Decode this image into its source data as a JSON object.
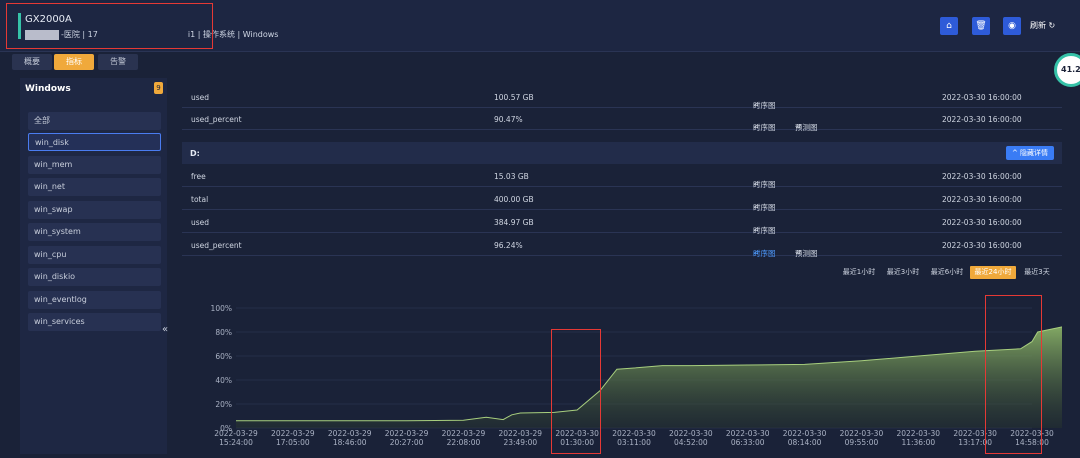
{
  "header": {
    "host_name": "GX2000A",
    "host_info_1": "-医院 | 17",
    "host_info_2": "i1 | 操作系统 | Windows",
    "refresh_label": "刷新"
  },
  "tabs": [
    {
      "label": "概要"
    },
    {
      "label": "指标"
    },
    {
      "label": "告警"
    }
  ],
  "gauge": {
    "value": "41.21"
  },
  "sidebar": {
    "title": "Windows",
    "badge": "9",
    "items": [
      {
        "label": "全部"
      },
      {
        "label": "win_disk"
      },
      {
        "label": "win_mem"
      },
      {
        "label": "win_net"
      },
      {
        "label": "win_swap"
      },
      {
        "label": "win_system"
      },
      {
        "label": "win_cpu"
      },
      {
        "label": "win_diskio"
      },
      {
        "label": "win_eventlog"
      },
      {
        "label": "win_services"
      }
    ],
    "collapse_icon": "«"
  },
  "table_top": [
    {
      "name": "used",
      "value": "100.57 GB",
      "ts": "时序图",
      "pred": "",
      "time": "2022-03-30 16:00:00"
    },
    {
      "name": "used_percent",
      "value": "90.47%",
      "ts": "时序图",
      "pred": "预测图",
      "time": "2022-03-30 16:00:00"
    }
  ],
  "section_d": {
    "title": "D:",
    "hide_label": "^ 隐藏详情",
    "rows": [
      {
        "name": "free",
        "value": "15.03 GB",
        "ts": "时序图",
        "pred": "",
        "time": "2022-03-30 16:00:00"
      },
      {
        "name": "total",
        "value": "400.00 GB",
        "ts": "时序图",
        "pred": "",
        "time": "2022-03-30 16:00:00"
      },
      {
        "name": "used",
        "value": "384.97 GB",
        "ts": "时序图",
        "pred": "",
        "time": "2022-03-30 16:00:00"
      },
      {
        "name": "used_percent",
        "value": "96.24%",
        "ts": "时序图",
        "pred": "预测图",
        "time": "2022-03-30 16:00:00"
      }
    ]
  },
  "ranges": [
    {
      "label": "最近1小时"
    },
    {
      "label": "最近3小时"
    },
    {
      "label": "最近6小时"
    },
    {
      "label": "最近24小时"
    },
    {
      "label": "最近3天"
    }
  ],
  "chart_data": {
    "type": "area",
    "y_ticks": [
      "100%",
      "80%",
      "60%",
      "40%",
      "20%",
      "0%"
    ],
    "ylim": [
      0,
      100
    ],
    "x_ticks": [
      [
        "2022-03-29",
        "15:24:00"
      ],
      [
        "2022-03-29",
        "17:05:00"
      ],
      [
        "2022-03-29",
        "18:46:00"
      ],
      [
        "2022-03-29",
        "20:27:00"
      ],
      [
        "2022-03-29",
        "22:08:00"
      ],
      [
        "2022-03-29",
        "23:49:00"
      ],
      [
        "2022-03-30",
        "01:30:00"
      ],
      [
        "2022-03-30",
        "03:11:00"
      ],
      [
        "2022-03-30",
        "04:52:00"
      ],
      [
        "2022-03-30",
        "06:33:00"
      ],
      [
        "2022-03-30",
        "08:14:00"
      ],
      [
        "2022-03-30",
        "09:55:00"
      ],
      [
        "2022-03-30",
        "11:36:00"
      ],
      [
        "2022-03-30",
        "13:17:00"
      ],
      [
        "2022-03-30",
        "14:58:00"
      ]
    ],
    "series": [
      {
        "color": "#8fb86a",
        "points": [
          [
            0,
            6
          ],
          [
            1,
            6
          ],
          [
            2,
            6
          ],
          [
            3,
            6
          ],
          [
            4,
            6.5
          ],
          [
            4.4,
            9
          ],
          [
            4.7,
            7
          ],
          [
            4.85,
            11
          ],
          [
            5,
            12.5
          ],
          [
            5.6,
            13
          ],
          [
            6,
            15
          ],
          [
            6.4,
            31
          ],
          [
            6.7,
            49
          ],
          [
            7,
            50
          ],
          [
            7.5,
            52
          ],
          [
            8,
            52
          ],
          [
            9,
            52.5
          ],
          [
            10,
            53
          ],
          [
            11,
            56
          ],
          [
            12,
            60
          ],
          [
            13,
            64
          ],
          [
            13.8,
            66
          ],
          [
            14,
            72
          ],
          [
            14.1,
            80
          ],
          [
            14.5,
            84
          ],
          [
            14.9,
            88
          ]
        ]
      }
    ]
  },
  "colors": {
    "accent": "#f0a93b",
    "primary": "#2e5bd8",
    "highlight": "#e53935"
  }
}
